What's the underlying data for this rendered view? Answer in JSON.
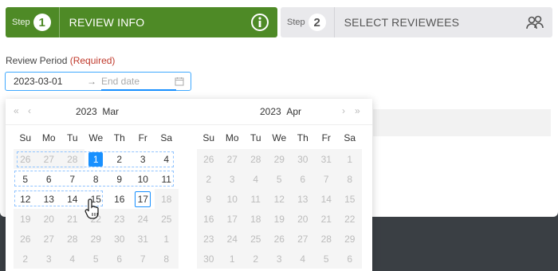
{
  "steps": [
    {
      "small": "Step",
      "num": "1",
      "title": "REVIEW INFO",
      "icon": "info-icon"
    },
    {
      "small": "Step",
      "num": "2",
      "title": "SELECT REVIEWEES",
      "icon": "users-icon"
    }
  ],
  "form": {
    "label": "Review Period",
    "required": "(Required)",
    "start_value": "2023-03-01",
    "arrow": "→",
    "end_placeholder": "End date"
  },
  "calendar": {
    "left": {
      "year": "2023",
      "month": "Mar"
    },
    "right": {
      "year": "2023",
      "month": "Apr"
    },
    "prev_year": "«",
    "prev_month": "‹",
    "next_month": "›",
    "next_year": "»",
    "weekdays": [
      "Su",
      "Mo",
      "Tu",
      "We",
      "Th",
      "Fr",
      "Sa"
    ],
    "left_weeks": [
      [
        "26",
        "27",
        "28",
        "1",
        "2",
        "3",
        "4"
      ],
      [
        "5",
        "6",
        "7",
        "8",
        "9",
        "10",
        "11"
      ],
      [
        "12",
        "13",
        "14",
        "15",
        "16",
        "17",
        "18"
      ],
      [
        "19",
        "20",
        "21",
        "22",
        "23",
        "24",
        "25"
      ],
      [
        "26",
        "27",
        "28",
        "29",
        "30",
        "31",
        "1"
      ],
      [
        "2",
        "3",
        "4",
        "5",
        "6",
        "7",
        "8"
      ]
    ],
    "right_weeks": [
      [
        "26",
        "27",
        "28",
        "29",
        "30",
        "31",
        "1"
      ],
      [
        "2",
        "3",
        "4",
        "5",
        "6",
        "7",
        "8"
      ],
      [
        "9",
        "10",
        "11",
        "12",
        "13",
        "14",
        "15"
      ],
      [
        "16",
        "17",
        "18",
        "19",
        "20",
        "21",
        "22"
      ],
      [
        "23",
        "24",
        "25",
        "26",
        "27",
        "28",
        "29"
      ],
      [
        "30",
        "1",
        "2",
        "3",
        "4",
        "5",
        "6"
      ]
    ]
  },
  "colors": {
    "step_active": "#4e8a26",
    "accent": "#1890ff",
    "required": "#c0392b"
  }
}
